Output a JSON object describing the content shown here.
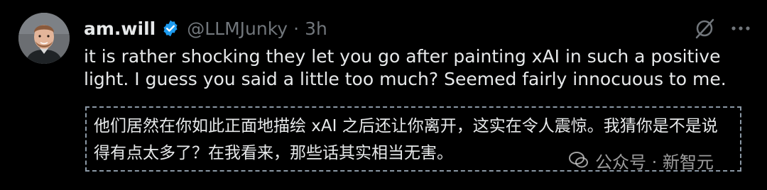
{
  "user": {
    "display_name": "am.will",
    "handle": "@LLMJunky",
    "separator": "·",
    "time": "3h",
    "avatar_icon": "person-avatar-icon",
    "verified_color": "#1d9bf0"
  },
  "tweet": {
    "text": "it is rather shocking they let you go after painting xAI in such a positive light. I guess you said a little too much? Seemed fairly innocuous to me."
  },
  "translation": {
    "text": "他们居然在你如此正面地描绘 xAI 之后还让你离开，这实在令人震惊。我猜你是不是说得有点太多了？在我看来，那些话其实相当无害。"
  },
  "watermark": {
    "text": "公众号 · 新智元",
    "logo_icon": "wechat-logo-icon"
  },
  "icons": {
    "grok": "grok-icon",
    "more": "more-options-icon"
  },
  "colors": {
    "background": "#000000",
    "text": "#e7e9ea",
    "muted": "#71767b"
  }
}
